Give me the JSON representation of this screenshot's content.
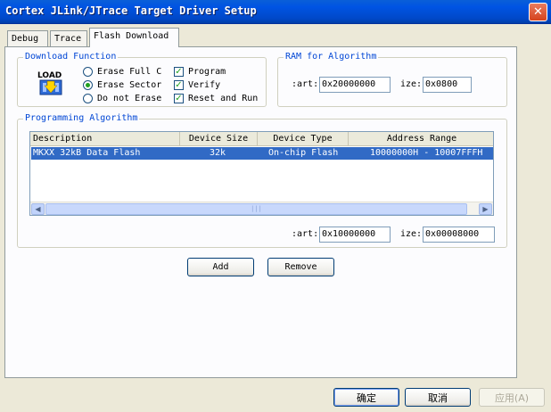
{
  "window": {
    "title": "Cortex JLink/JTrace Target Driver Setup"
  },
  "tabs": [
    {
      "label": "Debug"
    },
    {
      "label": "Trace"
    },
    {
      "label": "Flash Download"
    }
  ],
  "download_function": {
    "group_label": "Download Function",
    "icon_label": "LOAD",
    "erase_options": [
      {
        "label": "Erase Full C",
        "selected": false
      },
      {
        "label": "Erase Sector",
        "selected": true
      },
      {
        "label": "Do not Erase",
        "selected": false
      }
    ],
    "checks": [
      {
        "label": "Program",
        "checked": true
      },
      {
        "label": "Verify",
        "checked": true
      },
      {
        "label": "Reset and Run",
        "checked": true
      }
    ]
  },
  "ram_for_algorithm": {
    "group_label": "RAM for Algorithm",
    "start_label": ":art:",
    "start_value": "0x20000000",
    "size_label": "ize:",
    "size_value": "0x0800"
  },
  "programming_algorithm": {
    "group_label": "Programming Algorithm",
    "columns": [
      "Description",
      "Device Size",
      "Device Type",
      "Address Range"
    ],
    "rows": [
      {
        "description": "MKXX 32kB Data Flash",
        "size": "32k",
        "type": "On-chip Flash",
        "range": "10000000H - 10007FFFH"
      }
    ],
    "start_label": ":art:",
    "start_value": "0x10000000",
    "size_label": "ize:",
    "size_value": "0x00008000"
  },
  "buttons": {
    "add": "Add",
    "remove": "Remove",
    "ok": "确定",
    "cancel": "取消",
    "apply": "应用(A)"
  },
  "colors": {
    "titlebar": "#0054e3",
    "selection": "#316ac5",
    "group_label": "#0046d5"
  }
}
